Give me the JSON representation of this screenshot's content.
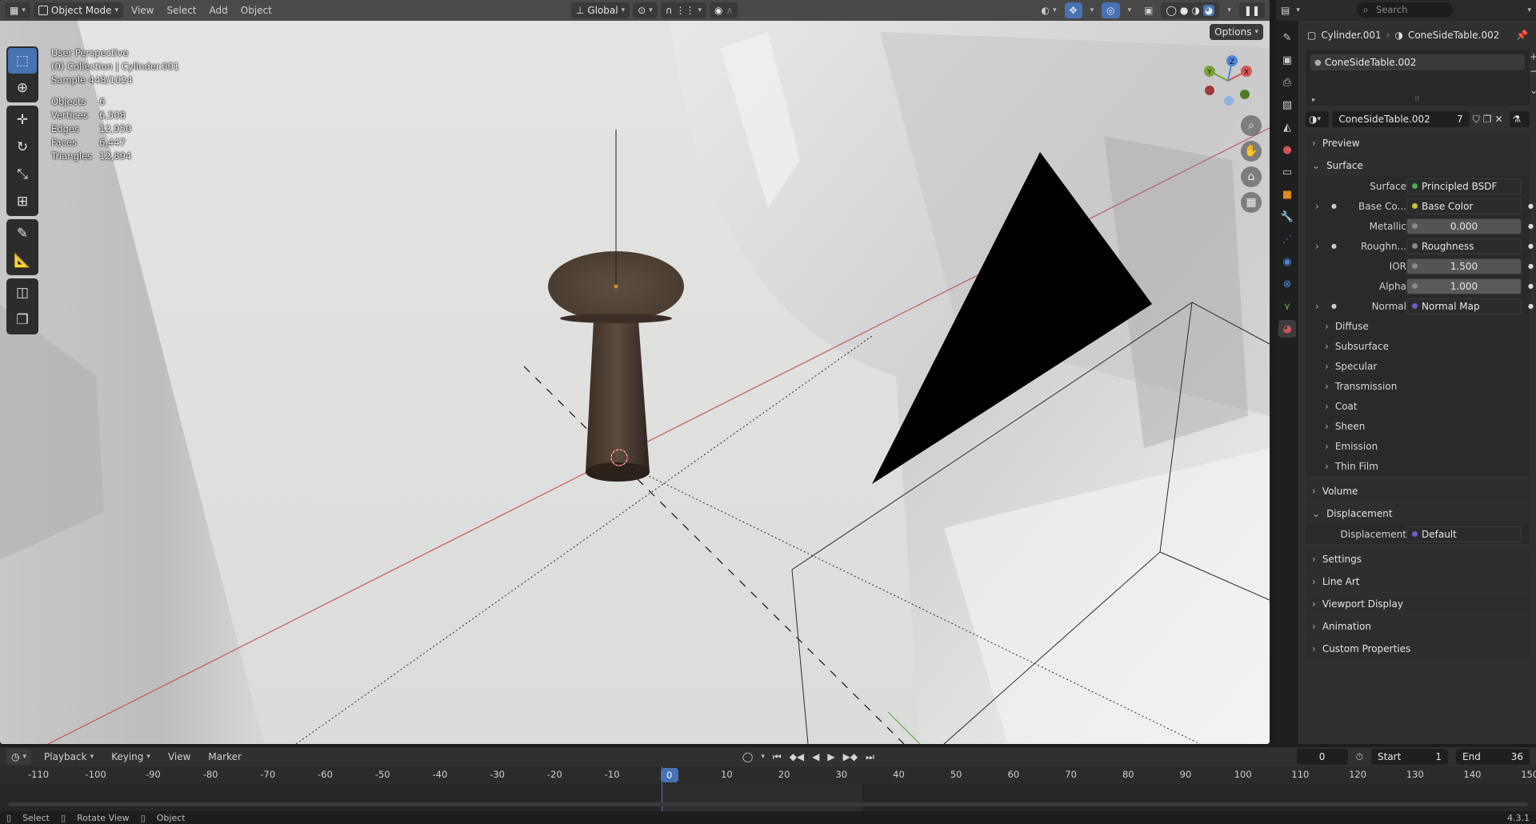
{
  "header": {
    "mode": "Object Mode",
    "menus": [
      "View",
      "Select",
      "Add",
      "Object"
    ],
    "transform_orientation": "Global",
    "options": "Options"
  },
  "overlay": {
    "perspective": "User Perspective",
    "collection": "(0) Collection | Cylinder.001",
    "sample": "Sample 448/1024",
    "stats": [
      {
        "label": "Objects",
        "value": "6"
      },
      {
        "label": "Vertices",
        "value": "6,508"
      },
      {
        "label": "Edges",
        "value": "12,950"
      },
      {
        "label": "Faces",
        "value": "6,447"
      },
      {
        "label": "Triangles",
        "value": "12,894"
      }
    ]
  },
  "gizmo": {
    "x": "X",
    "y": "Y",
    "z": "Z"
  },
  "properties": {
    "search_placeholder": "Search",
    "breadcrumb_object": "Cylinder.001",
    "breadcrumb_material": "ConeSideTable.002",
    "slot_name": "ConeSideTable.002",
    "material_name": "ConeSideTable.002",
    "users": "7",
    "sections": {
      "preview": "Preview",
      "surface": "Surface",
      "volume": "Volume",
      "displacement": "Displacement",
      "settings": "Settings",
      "line_art": "Line Art",
      "viewport_display": "Viewport Display",
      "animation": "Animation",
      "custom_properties": "Custom Properties"
    },
    "surface_rows": [
      {
        "label": "Surface",
        "value": "Principled BSDF",
        "dot": "#4caf50",
        "kind": "link"
      },
      {
        "label": "Base Co...",
        "value": "Base Color",
        "dot": "#c7c729",
        "kind": "link",
        "expand": true
      },
      {
        "label": "Metallic",
        "value": "0.000",
        "dot": "#8a8a8a",
        "kind": "num"
      },
      {
        "label": "Roughn...",
        "value": "Roughness",
        "dot": "#8a8a8a",
        "kind": "link",
        "expand": true
      },
      {
        "label": "IOR",
        "value": "1.500",
        "dot": "#8a8a8a",
        "kind": "num"
      },
      {
        "label": "Alpha",
        "value": "1.000",
        "dot": "#8a8a8a",
        "kind": "num",
        "dark": true
      },
      {
        "label": "Normal",
        "value": "Normal Map",
        "dot": "#6363c7",
        "kind": "link",
        "expand": true
      }
    ],
    "surface_subs": [
      "Diffuse",
      "Subsurface",
      "Specular",
      "Transmission",
      "Coat",
      "Sheen",
      "Emission",
      "Thin Film"
    ],
    "displacement_row": {
      "label": "Displacement",
      "value": "Default",
      "dot": "#6363c7"
    }
  },
  "timeline": {
    "menus": [
      "Playback",
      "Keying",
      "View",
      "Marker"
    ],
    "current_frame": "0",
    "start_label": "Start",
    "start": "1",
    "end_label": "End",
    "end": "36",
    "ticks": [
      "-110",
      "-100",
      "-90",
      "-80",
      "-70",
      "-60",
      "-50",
      "-40",
      "-30",
      "-20",
      "-10",
      "0",
      "10",
      "20",
      "30",
      "40",
      "50",
      "60",
      "70",
      "80",
      "90",
      "100",
      "110",
      "120",
      "130",
      "140",
      "150"
    ]
  },
  "status": {
    "select": "Select",
    "rotate": "Rotate View",
    "object": "Object",
    "version": "4.3.1"
  }
}
